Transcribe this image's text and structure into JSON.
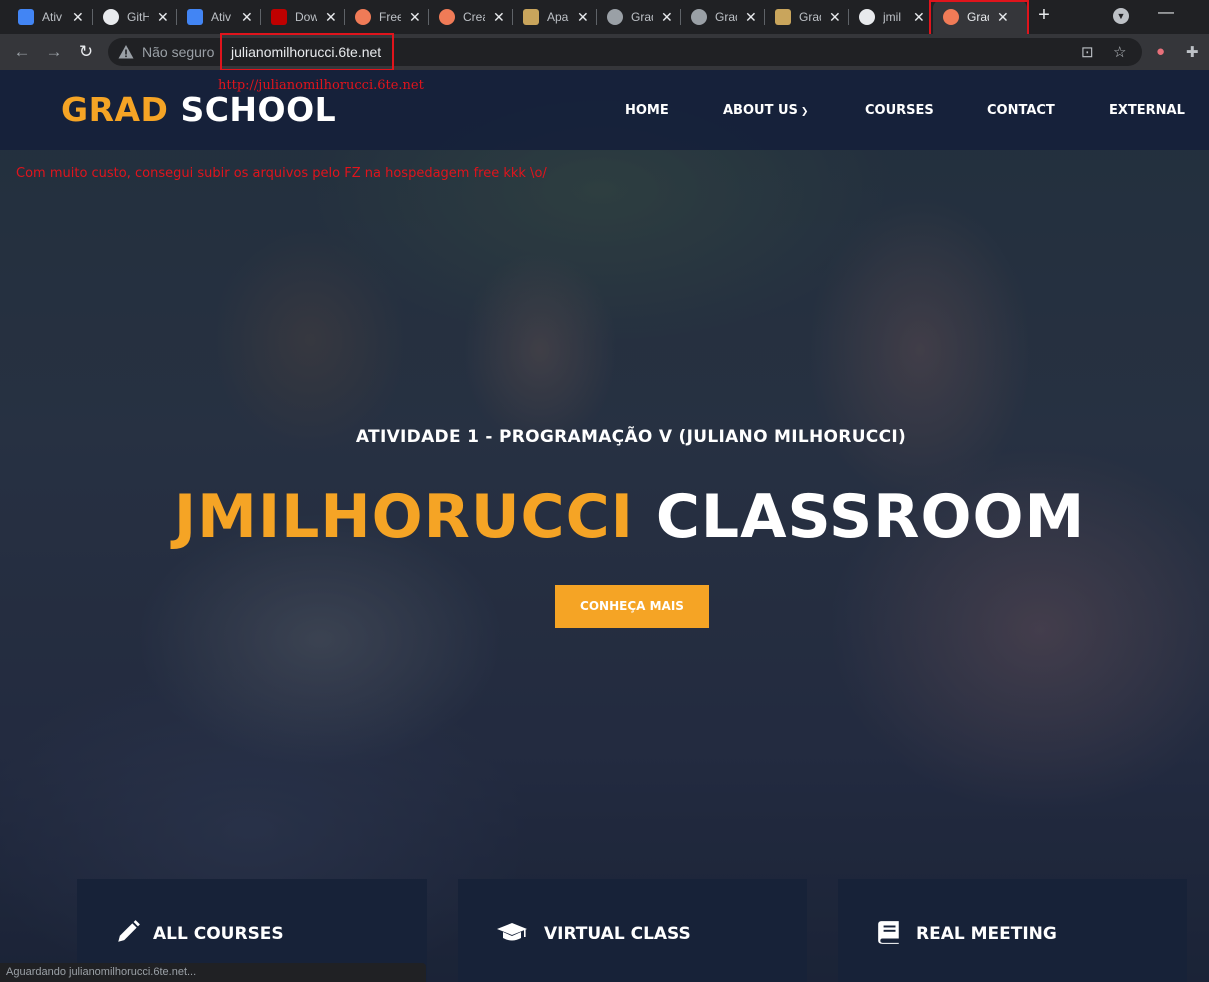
{
  "browser": {
    "tabs": [
      {
        "title": "Ativ",
        "favicon": "google-classroom-icon",
        "color": "#4285f4"
      },
      {
        "title": "GitH",
        "favicon": "github-icon",
        "color": "#e8eaed"
      },
      {
        "title": "Ativ",
        "favicon": "google-docs-icon",
        "color": "#4285f4"
      },
      {
        "title": "Dow",
        "favicon": "filezilla-icon",
        "color": "#bf0000"
      },
      {
        "title": "Free",
        "favicon": "site-icon",
        "color": "#f07b57"
      },
      {
        "title": "Crea",
        "favicon": "site-icon",
        "color": "#f07b57"
      },
      {
        "title": "Apa",
        "favicon": "apache-icon",
        "color": "#c9a55c"
      },
      {
        "title": "Grad",
        "favicon": "globe-icon",
        "color": "#9aa0a6"
      },
      {
        "title": "Grad",
        "favicon": "globe-icon",
        "color": "#9aa0a6"
      },
      {
        "title": "Grad",
        "favicon": "apache-icon",
        "color": "#c9a55c"
      },
      {
        "title": "jmil",
        "favicon": "github-icon",
        "color": "#e8eaed"
      },
      {
        "title": "Grad",
        "favicon": "site-icon",
        "color": "#f07b57",
        "active": true
      }
    ],
    "new_tab": "+",
    "insecure_label": "Não seguro",
    "url": "julianomilhorucci.6te.net",
    "status_text": "Aguardando julianomilhorucci.6te.net..."
  },
  "annotations": {
    "url_note": "http://julianomilhorucci.6te.net",
    "upload_note": "Com muito custo, consegui subir os arquivos pelo FZ na hospedagem free kkk \\o/"
  },
  "site": {
    "logo_part1": "GRAD",
    "logo_part2": "SCHOOL",
    "nav": [
      "HOME",
      "ABOUT US",
      "COURSES",
      "CONTACT",
      "EXTERNAL"
    ],
    "subtitle": "ATIVIDADE 1 - PROGRAMAÇÃO V (JULIANO MILHORUCCI)",
    "headline_part1": "JMILHORUCCI",
    "headline_part2": "CLASSROOM",
    "cta": "CONHEÇA MAIS",
    "features": [
      {
        "label": "ALL COURSES",
        "icon": "pencil-icon"
      },
      {
        "label": "VIRTUAL CLASS",
        "icon": "graduation-cap-icon"
      },
      {
        "label": "REAL MEETING",
        "icon": "book-icon"
      }
    ],
    "colors": {
      "accent": "#f5a425",
      "header": "#16203a",
      "feature_bg": "#172238",
      "annotation": "#e0141c"
    }
  }
}
